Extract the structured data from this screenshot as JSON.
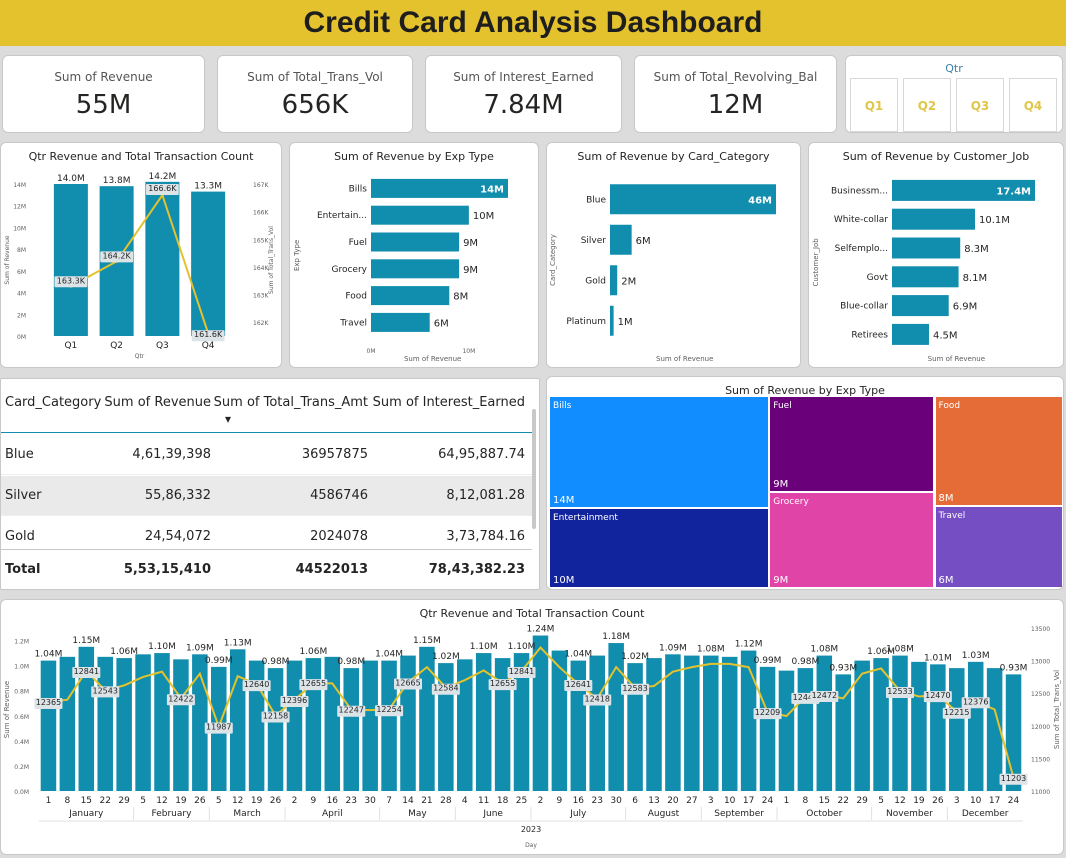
{
  "title": "Credit Card Analysis Dashboard",
  "kpis": [
    {
      "label": "Sum of Revenue",
      "value": "55M"
    },
    {
      "label": "Sum of Total_Trans_Vol",
      "value": "656K"
    },
    {
      "label": "Sum of Interest_Earned",
      "value": "7.84M"
    },
    {
      "label": "Sum of Total_Revolving_Bal",
      "value": "12M"
    }
  ],
  "slicer": {
    "title": "Qtr",
    "options": [
      "Q1",
      "Q2",
      "Q3",
      "Q4"
    ]
  },
  "colors": {
    "bar": "#118dad",
    "line": "#e3c22e",
    "title_bar": "#e3c22e",
    "slicer_text": "#e0c64a"
  },
  "chart_data": [
    {
      "type": "bar",
      "title": "Qtr Revenue and Total Transaction Count",
      "xlabel": "Qtr",
      "ylabel": "Sum of Revenue",
      "y2label": "Sum of Total_Trans_Vol",
      "categories": [
        "Q1",
        "Q2",
        "Q3",
        "Q4"
      ],
      "series": [
        {
          "values": [
            14.0,
            13.8,
            14.2,
            13.3
          ],
          "labels": [
            "14.0M",
            "13.8M",
            "14.2M",
            "13.3M"
          ]
        },
        {
          "type": "line",
          "values": [
            163.3,
            164.2,
            166.6,
            161.6
          ],
          "labels": [
            "163.3K",
            "164.2K",
            "166.6K",
            "161.6K"
          ]
        }
      ],
      "yticks": [
        "0M",
        "2M",
        "4M",
        "6M",
        "8M",
        "10M",
        "12M",
        "14M"
      ],
      "ylim": [
        0,
        14
      ],
      "y2ticks": [
        "162K",
        "163K",
        "164K",
        "165K",
        "166K",
        "167K"
      ],
      "y2lim": [
        161.5,
        167
      ]
    },
    {
      "type": "bar",
      "orientation": "horizontal",
      "title": "Sum of Revenue by Exp Type",
      "ylabel": "Exp Type",
      "xlabel": "Sum of Revenue",
      "categories": [
        "Bills",
        "Entertain...",
        "Fuel",
        "Grocery",
        "Food",
        "Travel"
      ],
      "values": [
        14,
        10,
        9,
        9,
        8,
        6
      ],
      "labels": [
        "14M",
        "10M",
        "9M",
        "9M",
        "8M",
        "6M"
      ],
      "xticks": [
        "0M",
        "10M"
      ],
      "xlim": [
        0,
        14
      ]
    },
    {
      "type": "bar",
      "orientation": "horizontal",
      "title": "Sum of Revenue by Card_Category",
      "ylabel": "Card_Category",
      "xlabel": "Sum of Revenue",
      "categories": [
        "Blue",
        "Silver",
        "Gold",
        "Platinum"
      ],
      "values": [
        46,
        6,
        2,
        1
      ],
      "labels": [
        "46M",
        "6M",
        "2M",
        "1M"
      ],
      "xlim": [
        0,
        46
      ]
    },
    {
      "type": "bar",
      "orientation": "horizontal",
      "title": "Sum of Revenue by Customer_Job",
      "ylabel": "Customer_Job",
      "xlabel": "Sum of Revenue",
      "categories": [
        "Businessm...",
        "White-collar",
        "Selfemplo...",
        "Govt",
        "Blue-collar",
        "Retirees"
      ],
      "values": [
        17.4,
        10.1,
        8.3,
        8.1,
        6.9,
        4.5
      ],
      "labels": [
        "17.4M",
        "10.1M",
        "8.3M",
        "8.1M",
        "6.9M",
        "4.5M"
      ],
      "xlim": [
        0,
        17.4
      ]
    },
    {
      "type": "table",
      "columns": [
        "Card_Category",
        "Sum of Revenue",
        "Sum of Total_Trans_Amt",
        "Sum of Interest_Earned"
      ],
      "rows": [
        [
          "Blue",
          "4,61,39,398",
          "36957875",
          "64,95,887.74"
        ],
        [
          "Silver",
          "55,86,332",
          "4586746",
          "8,12,081.28"
        ],
        [
          "Gold",
          "24,54,072",
          "2024078",
          "3,73,784.16"
        ]
      ],
      "total": [
        "Total",
        "5,53,15,410",
        "44522013",
        "78,43,382.23"
      ]
    },
    {
      "type": "treemap",
      "title": "Sum of Revenue by Exp Type",
      "categories": [
        "Bills",
        "Entertainment",
        "Fuel",
        "Grocery",
        "Food",
        "Travel"
      ],
      "values": [
        14,
        10,
        9,
        9,
        8,
        6
      ],
      "labels": [
        "14M",
        "10M",
        "9M",
        "9M",
        "8M",
        "6M"
      ],
      "colors": [
        "#118dff",
        "#12239e",
        "#6b007b",
        "#e044a7",
        "#e66c37",
        "#744ec2"
      ]
    },
    {
      "type": "bar",
      "title": "Qtr Revenue and Total Transaction Count",
      "xlabel": "Day",
      "ylabel": "Sum of Revenue",
      "y2label": "Sum of Total_Trans_Vol",
      "year": "2023",
      "x": [
        "1",
        "8",
        "15",
        "22",
        "29",
        "5",
        "12",
        "19",
        "26",
        "5",
        "12",
        "19",
        "26",
        "2",
        "9",
        "16",
        "23",
        "30",
        "7",
        "14",
        "21",
        "28",
        "4",
        "11",
        "18",
        "25",
        "2",
        "9",
        "16",
        "23",
        "30",
        "6",
        "13",
        "20",
        "27",
        "3",
        "10",
        "17",
        "24",
        "1",
        "8",
        "15",
        "22",
        "29",
        "5",
        "12",
        "19",
        "26",
        "3",
        "10",
        "17",
        "24"
      ],
      "months": [
        {
          "name": "January",
          "count": 5
        },
        {
          "name": "February",
          "count": 4
        },
        {
          "name": "March",
          "count": 4
        },
        {
          "name": "April",
          "count": 5
        },
        {
          "name": "May",
          "count": 4
        },
        {
          "name": "June",
          "count": 4
        },
        {
          "name": "July",
          "count": 5
        },
        {
          "name": "August",
          "count": 4
        },
        {
          "name": "September",
          "count": 4
        },
        {
          "name": "October",
          "count": 5
        },
        {
          "name": "November",
          "count": 4
        },
        {
          "name": "December",
          "count": 4
        }
      ],
      "series": [
        {
          "name": "Sum of Revenue",
          "values": [
            1.04,
            1.07,
            1.15,
            1.07,
            1.06,
            1.09,
            1.1,
            1.05,
            1.09,
            0.99,
            1.13,
            1.04,
            0.98,
            1.04,
            1.06,
            1.07,
            0.98,
            1.04,
            1.04,
            1.08,
            1.15,
            1.02,
            1.05,
            1.1,
            1.06,
            1.1,
            1.24,
            1.12,
            1.04,
            1.08,
            1.18,
            1.02,
            1.06,
            1.09,
            1.08,
            1.08,
            1.07,
            1.12,
            0.99,
            0.96,
            0.98,
            1.08,
            0.93,
            1.04,
            1.06,
            1.08,
            1.03,
            1.01,
            0.98,
            1.03,
            0.98,
            0.93
          ],
          "labels": {
            "0": "1.04M",
            "2": "1.15M",
            "4": "1.06M",
            "6": "1.10M",
            "8": "1.09M",
            "9": "0.99M",
            "10": "1.13M",
            "12": "0.98M",
            "14": "1.06M",
            "16": "0.98M",
            "18": "1.04M",
            "20": "1.15M",
            "21": "1.02M",
            "23": "1.10M",
            "25": "1.10M",
            "26": "1.24M",
            "28": "1.04M",
            "30": "1.18M",
            "31": "1.02M",
            "33": "1.09M",
            "35": "1.08M",
            "37": "1.12M",
            "38": "0.99M",
            "40": "0.98M",
            "41": "1.08M",
            "42": "0.93M",
            "44": "1.06M",
            "45": "1.08M",
            "47": "1.01M",
            "49": "1.03M",
            "51": "0.93M"
          }
        },
        {
          "name": "Sum of Total_Trans_Vol",
          "type": "line",
          "values": [
            12365,
            12400,
            12841,
            12543,
            12620,
            12750,
            12830,
            12422,
            12800,
            11987,
            12760,
            12640,
            12158,
            12396,
            12655,
            12650,
            12247,
            12240,
            12254,
            12665,
            12900,
            12584,
            12700,
            12850,
            12655,
            12841,
            13200,
            12900,
            12641,
            12418,
            12900,
            12583,
            12610,
            12830,
            12900,
            12950,
            12950,
            12900,
            12209,
            12150,
            12444,
            12472,
            12420,
            12800,
            12880,
            12533,
            12450,
            12470,
            12215,
            12376,
            12250,
            11203
          ],
          "labels": {
            "0": "12365",
            "2": "12841",
            "3": "12543",
            "7": "12422",
            "9": "11987",
            "11": "12640",
            "12": "12158",
            "13": "12396",
            "14": "12655",
            "16": "12247",
            "18": "12254",
            "19": "12665",
            "21": "12584",
            "24": "12655",
            "25": "12841",
            "28": "12641",
            "29": "12418",
            "31": "12583",
            "38": "12209",
            "40": "12444",
            "41": "12472",
            "45": "12533",
            "47": "12470",
            "48": "12215",
            "49": "12376",
            "51": "11203"
          }
        }
      ],
      "yticks": [
        "0.0M",
        "0.2M",
        "0.4M",
        "0.6M",
        "0.8M",
        "1.0M",
        "1.2M"
      ],
      "ylim": [
        0,
        1.3
      ],
      "y2ticks": [
        "11000",
        "11500",
        "12000",
        "12500",
        "13000",
        "13500"
      ],
      "y2lim": [
        11000,
        13500
      ]
    }
  ]
}
